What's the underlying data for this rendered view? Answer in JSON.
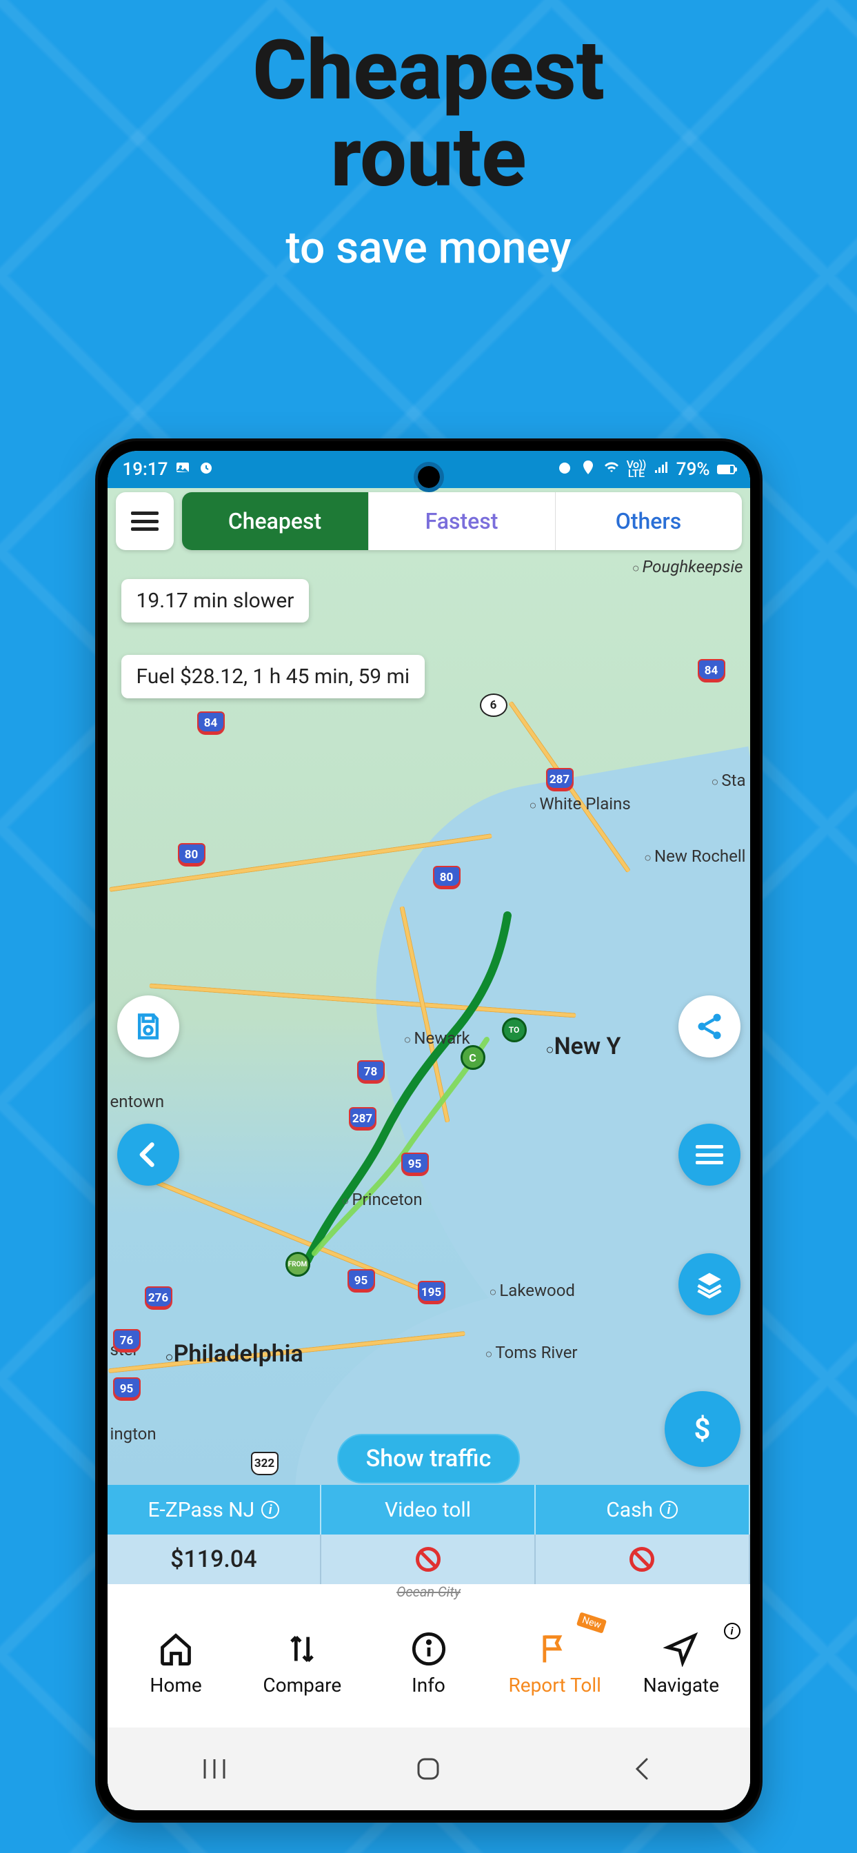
{
  "hero": {
    "title_line1": "Cheapest",
    "title_line2": "route",
    "subtitle": "to save money"
  },
  "statusbar": {
    "time": "19:17",
    "battery": "79%"
  },
  "tabs": {
    "cheapest": "Cheapest",
    "fastest": "Fastest",
    "others": "Others"
  },
  "map": {
    "chip_slower": "19.17 min slower",
    "chip_summary": "Fuel $28.12, 1 h 45 min, 59 mi",
    "show_traffic": "Show traffic",
    "ocean_strip": "Ocean City",
    "dollar": "$",
    "markers": {
      "from": "FROM",
      "c": "C",
      "to": "TO"
    },
    "places": {
      "poughkeepsie": "Poughkeepsie",
      "white_plains": "White Plains",
      "sta": "Sta",
      "new_rochell": "New Rochell",
      "newark": "Newark",
      "new_york": "New Y",
      "entown": "entown",
      "princeton": "Princeton",
      "lakewood": "Lakewood",
      "toms_river": "Toms River",
      "philadelphia": "Philadelphia",
      "ster": "ster",
      "ington": "ington"
    },
    "shields": {
      "s84a": "84",
      "s84b": "84",
      "s6": "6",
      "s287a": "287",
      "s80a": "80",
      "s80b": "80",
      "s78": "78",
      "s287b": "287",
      "s95a": "95",
      "s276": "276",
      "s76": "76",
      "s95b": "95",
      "s195": "195",
      "s95c": "95",
      "s322": "322"
    }
  },
  "pay": {
    "headers": [
      "E-ZPass NJ",
      "Video toll",
      "Cash"
    ],
    "price": "$119.04"
  },
  "appbar": {
    "home": "Home",
    "compare": "Compare",
    "info": "Info",
    "report": "Report Toll",
    "report_badge": "New",
    "navigate": "Navigate"
  }
}
